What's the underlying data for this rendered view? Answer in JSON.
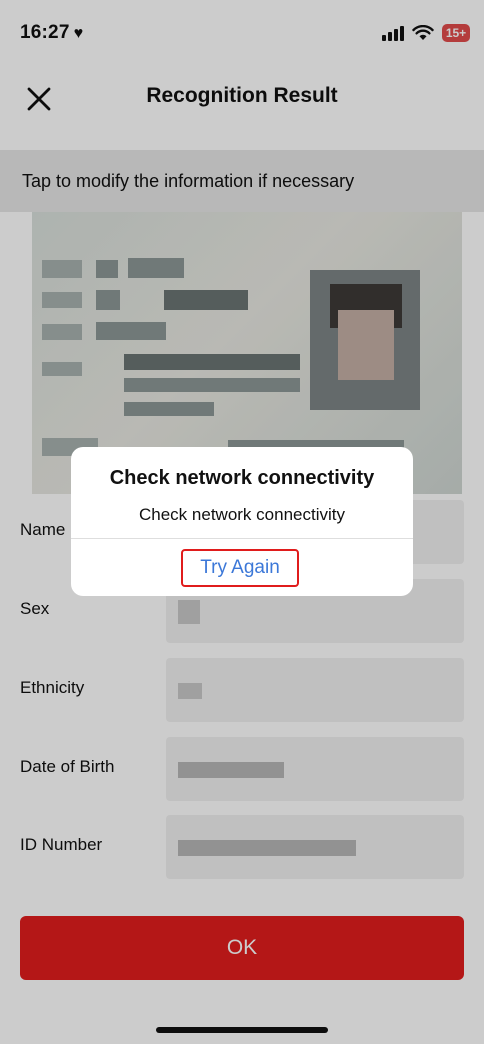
{
  "status_bar": {
    "time": "16:27",
    "battery": "15+",
    "icons": [
      "heart-icon",
      "signal-icon",
      "wifi-icon",
      "battery-icon"
    ]
  },
  "nav": {
    "title": "Recognition Result",
    "close_icon": "close-icon"
  },
  "hint": "Tap to modify the information if necessary",
  "form": {
    "name_label": "Name",
    "sex_label": "Sex",
    "ethnicity_label": "Ethnicity",
    "dob_label": "Date of Birth",
    "id_label": "ID Number"
  },
  "ok_button": "OK",
  "dialog": {
    "title": "Check network connectivity",
    "message": "Check network connectivity",
    "button": "Try Again"
  },
  "colors": {
    "primary_red": "#e11d1d",
    "link_blue": "#3c78d8",
    "battery_red": "#e24b4b"
  }
}
